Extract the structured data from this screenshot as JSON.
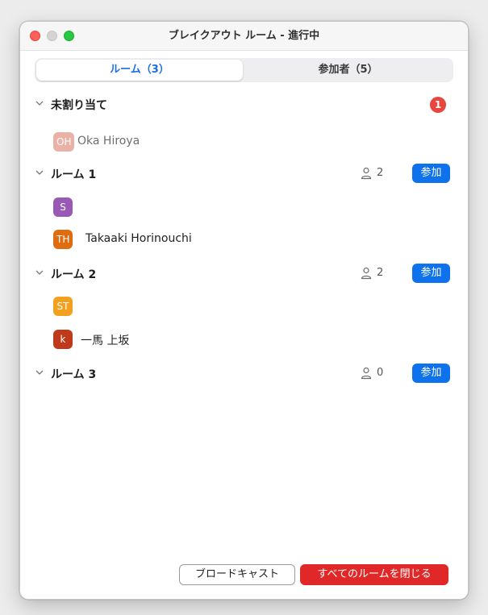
{
  "window": {
    "title": "ブレイクアウト ルーム - 進行中"
  },
  "tabs": [
    {
      "label": "ルーム（3）",
      "active": true
    },
    {
      "label": "参加者（5）",
      "active": false
    }
  ],
  "unassigned": {
    "label": "未割り当て",
    "badge": "1",
    "members": [
      {
        "initials": "OH",
        "name": "Oka Hiroya",
        "color": "#d9725e"
      }
    ]
  },
  "rooms": [
    {
      "label": "ルーム 1",
      "count": "2",
      "join_label": "参加",
      "members": [
        {
          "initials": "S",
          "name": "",
          "color": "#9b59b6"
        },
        {
          "initials": "TH",
          "name": "Takaaki Horinouchi",
          "color": "#e06c10"
        }
      ]
    },
    {
      "label": "ルーム 2",
      "count": "2",
      "join_label": "参加",
      "members": [
        {
          "initials": "ST",
          "name": "",
          "color": "#f2a01d"
        },
        {
          "initials": "k",
          "name": "一馬 上坂",
          "color": "#c0391a"
        }
      ]
    },
    {
      "label": "ルーム 3",
      "count": "0",
      "join_label": "参加",
      "members": []
    }
  ],
  "footer": {
    "broadcast_label": "ブロードキャスト",
    "close_all_label": "すべてのルームを閉じる"
  },
  "colors": {
    "accent": "#0e72ed",
    "danger": "#e02828",
    "badge": "#e7453d"
  },
  "icons": {
    "chevron": "chevron-down-icon",
    "person": "person-icon"
  }
}
